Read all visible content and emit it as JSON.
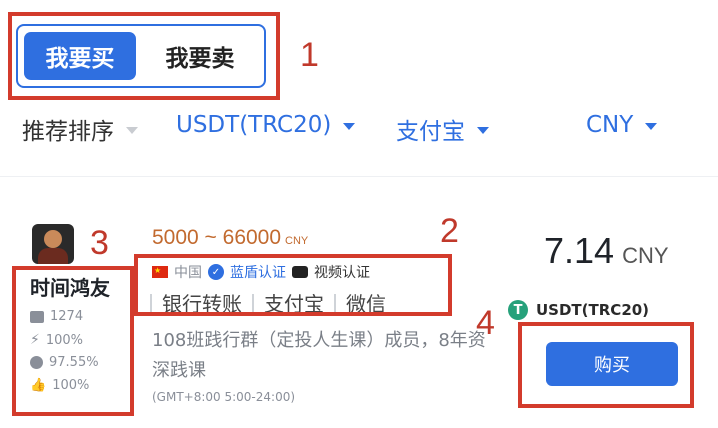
{
  "tabs": {
    "buy": "我要买",
    "sell": "我要卖"
  },
  "filters": {
    "sort": "推荐排序",
    "coin": "USDT(TRC20)",
    "payment": "支付宝",
    "fiat": "CNY"
  },
  "annotations": [
    "1",
    "2",
    "3",
    "4"
  ],
  "listing": {
    "merchant": "时间鸿友",
    "stats": {
      "trades": "1274",
      "completion": "100%",
      "rate": "97.55%",
      "positive": "100%"
    },
    "range": "5000 ~ 66000",
    "range_unit": "CNY",
    "country": "中国",
    "verify_shield": "蓝盾认证",
    "verify_video": "视频认证",
    "payments": [
      "银行转账",
      "支付宝",
      "微信"
    ],
    "description": "108班践行群（定投人生课）成员，8年资深践课",
    "hours": "(GMT+8:00 5:00-24:00)",
    "price": "7.14",
    "price_currency": "CNY",
    "token": "USDT(TRC20)",
    "token_icon": "T",
    "buy_label": "购买"
  },
  "colors": {
    "accent": "#2f6fe0",
    "range": "#c26a2f",
    "annotation": "#d33b2c",
    "tether": "#26a17b"
  }
}
